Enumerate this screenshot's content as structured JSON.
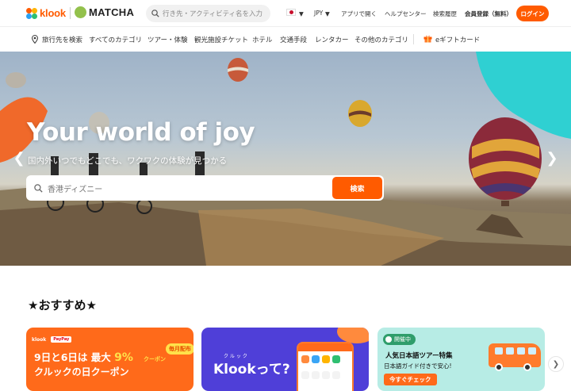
{
  "header": {
    "brand_klook": "klook",
    "brand_matcha": "MATCHA",
    "search_placeholder": "行き先・アクティビティ名を入力",
    "currency": "JPY",
    "links": [
      "アプリで開く",
      "ヘルプセンター",
      "検索履歴"
    ],
    "signup": "会員登録（無料）",
    "login": "ログイン",
    "accent_color": "#ff5b00"
  },
  "nav": {
    "items": [
      "旅行先を検索",
      "すべてのカテゴリ",
      "ツアー・体験",
      "観光施設チケット",
      "ホテル",
      "交通手段",
      "レンタカー",
      "その他のカテゴリ"
    ],
    "gift": "eギフトカード"
  },
  "hero": {
    "title": "Your world of joy",
    "subtitle": "国内外いつでもどこでも、ワクワクの体験が見つかる",
    "search_placeholder": "香港ディズニー",
    "search_button": "検索"
  },
  "recommend": {
    "title": "★おすすめ★",
    "cards": [
      {
        "logo_a": "klook",
        "logo_b": "PayPay",
        "headline_a": "9日と6日は",
        "headline_b": "最大",
        "percent": "9%",
        "coupon_word": "クーポン",
        "badge": "毎月配布",
        "headline_c": "クルックの日クーポン"
      },
      {
        "kana": "クルック",
        "headline": "Klookって?"
      },
      {
        "badge": "開催中",
        "headline": "人気日本語ツアー特集",
        "sub": "日本語ガイド付きで安心!",
        "cta": "今すぐチェック"
      }
    ]
  }
}
